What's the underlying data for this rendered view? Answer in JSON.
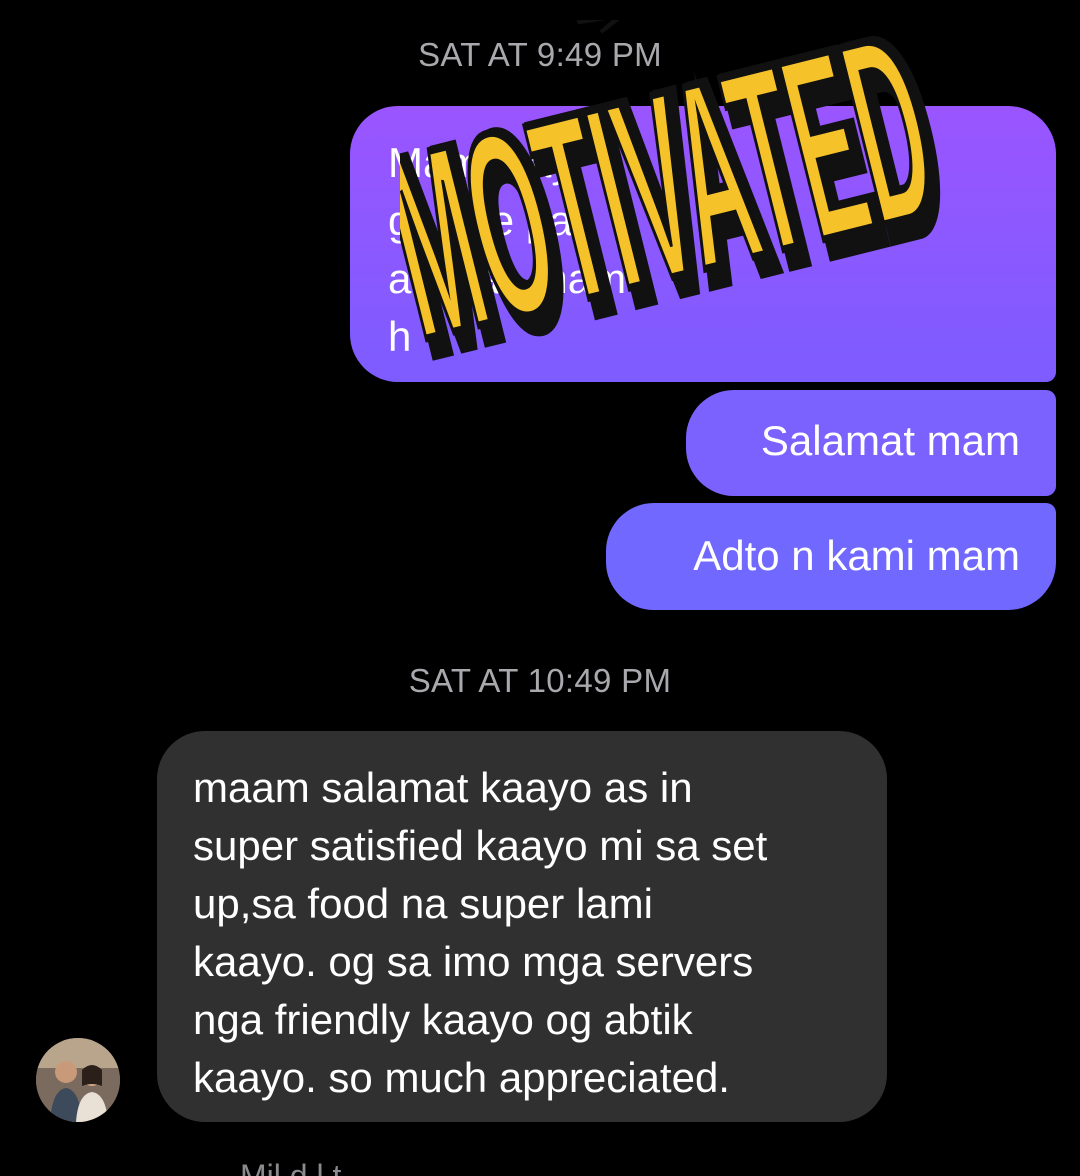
{
  "conversation": {
    "timestamp_1": "SAT AT 9:49 PM",
    "sent_messages": [
      {
        "text": "Mam may\ngoh                                   se pa\na                                  bwas mam\nh"
      },
      {
        "text": "Salamat mam"
      },
      {
        "text": "Adto n kami mam"
      }
    ],
    "timestamp_2": "SAT AT 10:49 PM",
    "received_message": {
      "text": "maam salamat kaayo as in\nsuper satisfied kaayo mi sa set\nup,sa food na super lami\nkaayo. og sa imo mga servers\nnga friendly kaayo og abtik\nkaayo. so much appreciated."
    },
    "partial_footer_text": "Mil    d l   t"
  },
  "sticker": {
    "text": "MOTIVATED",
    "fill_color": "#f5c22a",
    "outline_color": "#111111"
  },
  "colors": {
    "background": "#000000",
    "sent_bubble_top": "#9a55ff",
    "sent_bubble_bottom": "#7068ff",
    "received_bubble": "#303030",
    "timestamp": "#a8a8ad"
  }
}
